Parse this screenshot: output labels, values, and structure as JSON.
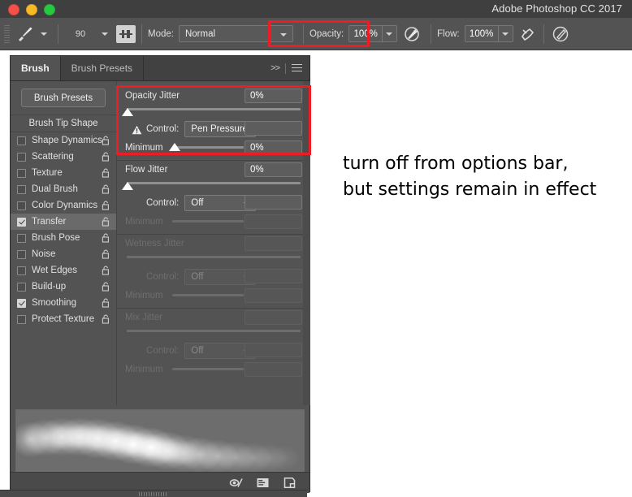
{
  "window": {
    "title": "Adobe Photoshop CC 2017",
    "traffic_lights": [
      "close",
      "minimize",
      "zoom"
    ]
  },
  "options_bar": {
    "brush_tool_icon": "brush-tool-icon",
    "brush_size": "90",
    "tablet_pressure_icon": "tablet-pressure-size-icon",
    "mode_label": "Mode:",
    "mode_value": "Normal",
    "opacity_label": "Opacity:",
    "opacity_value": "100%",
    "opacity_pressure_icon": "tablet-pressure-opacity-icon",
    "flow_label": "Flow:",
    "flow_value": "100%",
    "airbrush_icon": "airbrush-icon",
    "smoothing_icon": "smoothing-icon",
    "highlight_color": "#ee1c25"
  },
  "brush_panel": {
    "tabs": [
      {
        "label": "Brush",
        "active": true
      },
      {
        "label": "Brush Presets",
        "active": false
      }
    ],
    "collapse_icon": ">>",
    "menu_icon": "hamburger-menu-icon",
    "presets_button": "Brush Presets",
    "options_header": "Brush Tip Shape",
    "options": [
      {
        "label": "Shape Dynamics",
        "checked": false,
        "selected": false
      },
      {
        "label": "Scattering",
        "checked": false,
        "selected": false
      },
      {
        "label": "Texture",
        "checked": false,
        "selected": false
      },
      {
        "label": "Dual Brush",
        "checked": false,
        "selected": false
      },
      {
        "label": "Color Dynamics",
        "checked": false,
        "selected": false
      },
      {
        "label": "Transfer",
        "checked": true,
        "selected": true
      },
      {
        "label": "Brush Pose",
        "checked": false,
        "selected": false
      },
      {
        "label": "Noise",
        "checked": false,
        "selected": false
      },
      {
        "label": "Wet Edges",
        "checked": false,
        "selected": false
      },
      {
        "label": "Build-up",
        "checked": false,
        "selected": false
      },
      {
        "label": "Smoothing",
        "checked": true,
        "selected": false
      },
      {
        "label": "Protect Texture",
        "checked": false,
        "selected": false
      }
    ],
    "sections": [
      {
        "title": "Opacity Jitter",
        "value": "0%",
        "slider_pct": 0,
        "warning_icon": "warning-triangle-icon",
        "control_label": "Control:",
        "control_value": "Pen Pressure",
        "control_value_box": "",
        "minimum_label": "Minimum",
        "minimum_value": "0%",
        "minimum_pct": 0,
        "enabled": true,
        "highlighted": true
      },
      {
        "title": "Flow Jitter",
        "value": "0%",
        "slider_pct": 0,
        "warning_icon": "",
        "control_label": "Control:",
        "control_value": "Off",
        "control_value_box": "",
        "minimum_label": "Minimum",
        "minimum_value": "",
        "minimum_pct": 0,
        "enabled": true,
        "highlighted": false
      },
      {
        "title": "Wetness Jitter",
        "value": "",
        "slider_pct": 0,
        "warning_icon": "",
        "control_label": "Control:",
        "control_value": "Off",
        "control_value_box": "",
        "minimum_label": "Minimum",
        "minimum_value": "",
        "minimum_pct": 0,
        "enabled": false,
        "highlighted": false
      },
      {
        "title": "Mix Jitter",
        "value": "",
        "slider_pct": 0,
        "warning_icon": "",
        "control_label": "Control:",
        "control_value": "Off",
        "control_value_box": "",
        "minimum_label": "Minimum",
        "minimum_value": "",
        "minimum_pct": 0,
        "enabled": false,
        "highlighted": false
      }
    ],
    "preview_name": "brush-stroke-preview",
    "footer_icons": [
      "toggle-brush-preview-icon",
      "new-brush-preset-icon",
      "delete-brush-icon"
    ]
  },
  "annotation": {
    "line1": "turn off from options bar,",
    "line2": "but settings remain in effect"
  },
  "colors": {
    "panel_bg": "#535353",
    "titlebar_bg": "#3f3f3f",
    "highlight_red": "#ee1c25",
    "text": "#e6e6e6",
    "canvas_bg": "#ffffff"
  }
}
